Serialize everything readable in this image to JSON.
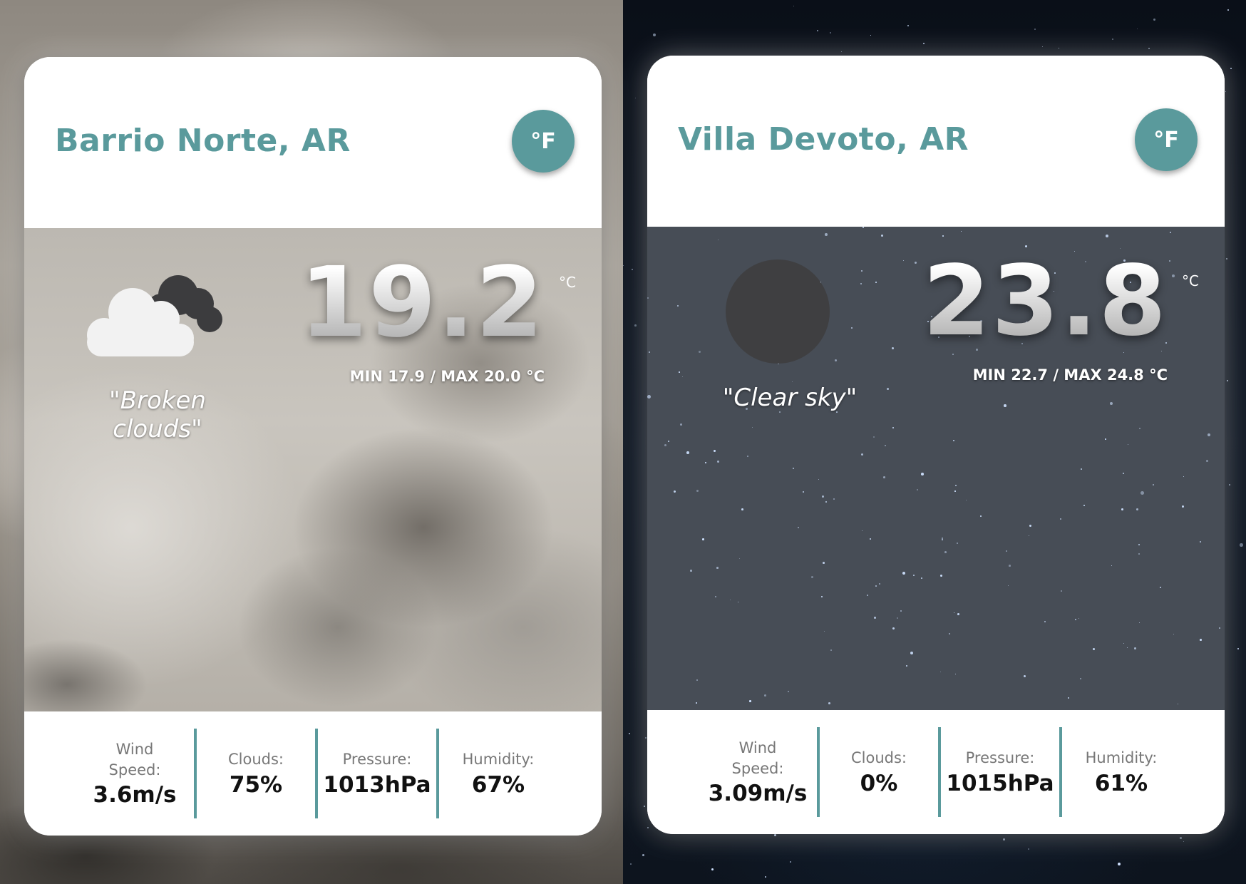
{
  "cards": [
    {
      "city": "Barrio Norte, AR",
      "unit_toggle": "°F",
      "icon": "broken-clouds-icon",
      "description": "\"Broken clouds\"",
      "temperature": "19.2",
      "temperature_unit": "°C",
      "min_max": "MIN 17.9 / MAX 20.0 °C",
      "stats": {
        "wind_label": "Wind Speed:",
        "wind_value": "3.6m/s",
        "clouds_label": "Clouds:",
        "clouds_value": "75%",
        "pressure_label": "Pressure:",
        "pressure_value": "1013hPa",
        "humidity_label": "Humidity:",
        "humidity_value": "67%"
      }
    },
    {
      "city": "Villa Devoto, AR",
      "unit_toggle": "°F",
      "icon": "clear-night-moon-icon",
      "description": "\"Clear sky\"",
      "temperature": "23.8",
      "temperature_unit": "°C",
      "min_max": "MIN 22.7 / MAX 24.8 °C",
      "stats": {
        "wind_label": "Wind Speed:",
        "wind_value": "3.09m/s",
        "clouds_label": "Clouds:",
        "clouds_value": "0%",
        "pressure_label": "Pressure:",
        "pressure_value": "1015hPa",
        "humidity_label": "Humidity:",
        "humidity_value": "61%"
      }
    }
  ],
  "colors": {
    "accent": "#5a9a9c",
    "cloud_light": "#f2f2f2",
    "cloud_dark": "#3c3c3e",
    "moon": "#3f3f41"
  }
}
